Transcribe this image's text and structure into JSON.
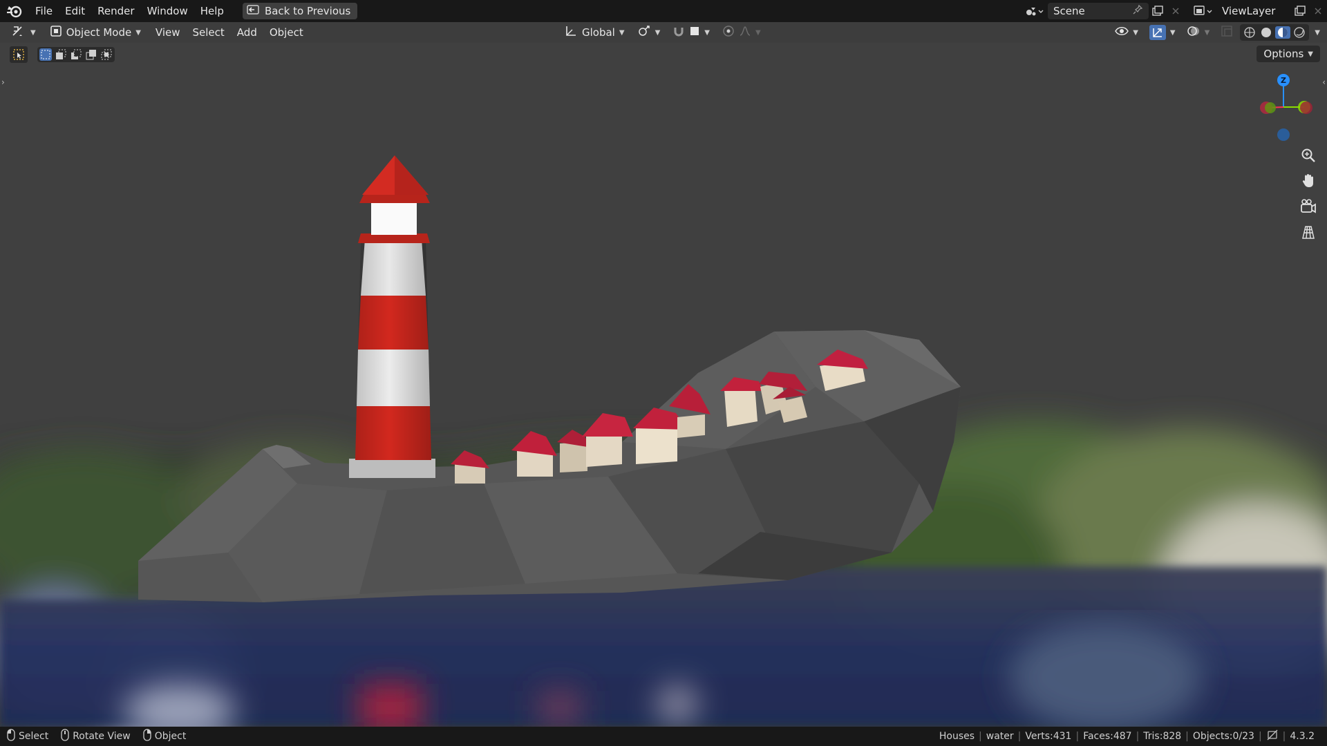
{
  "topbar": {
    "menus": [
      "File",
      "Edit",
      "Render",
      "Window",
      "Help"
    ],
    "back_button": "Back to Previous",
    "scene_name": "Scene",
    "view_layer": "ViewLayer"
  },
  "viewport_header": {
    "mode": "Object Mode",
    "menus": [
      "View",
      "Select",
      "Add",
      "Object"
    ],
    "transform_orientation": "Global",
    "options_label": "Options"
  },
  "gizmo": {
    "z_label": "Z"
  },
  "statusbar": {
    "hints": [
      {
        "label": "Select"
      },
      {
        "label": "Rotate View"
      },
      {
        "label": "Object"
      }
    ],
    "stats": [
      "Houses",
      "water",
      "Verts:431",
      "Faces:487",
      "Tris:828",
      "Objects:0/23"
    ],
    "version": "4.3.2"
  },
  "colors": {
    "accent_blue": "#4772b3",
    "axis_x": "#ff3352",
    "axis_y": "#8bdc00",
    "axis_z": "#2890ff",
    "lighthouse_red": "#d2281e",
    "roof_red": "#b8213a"
  }
}
